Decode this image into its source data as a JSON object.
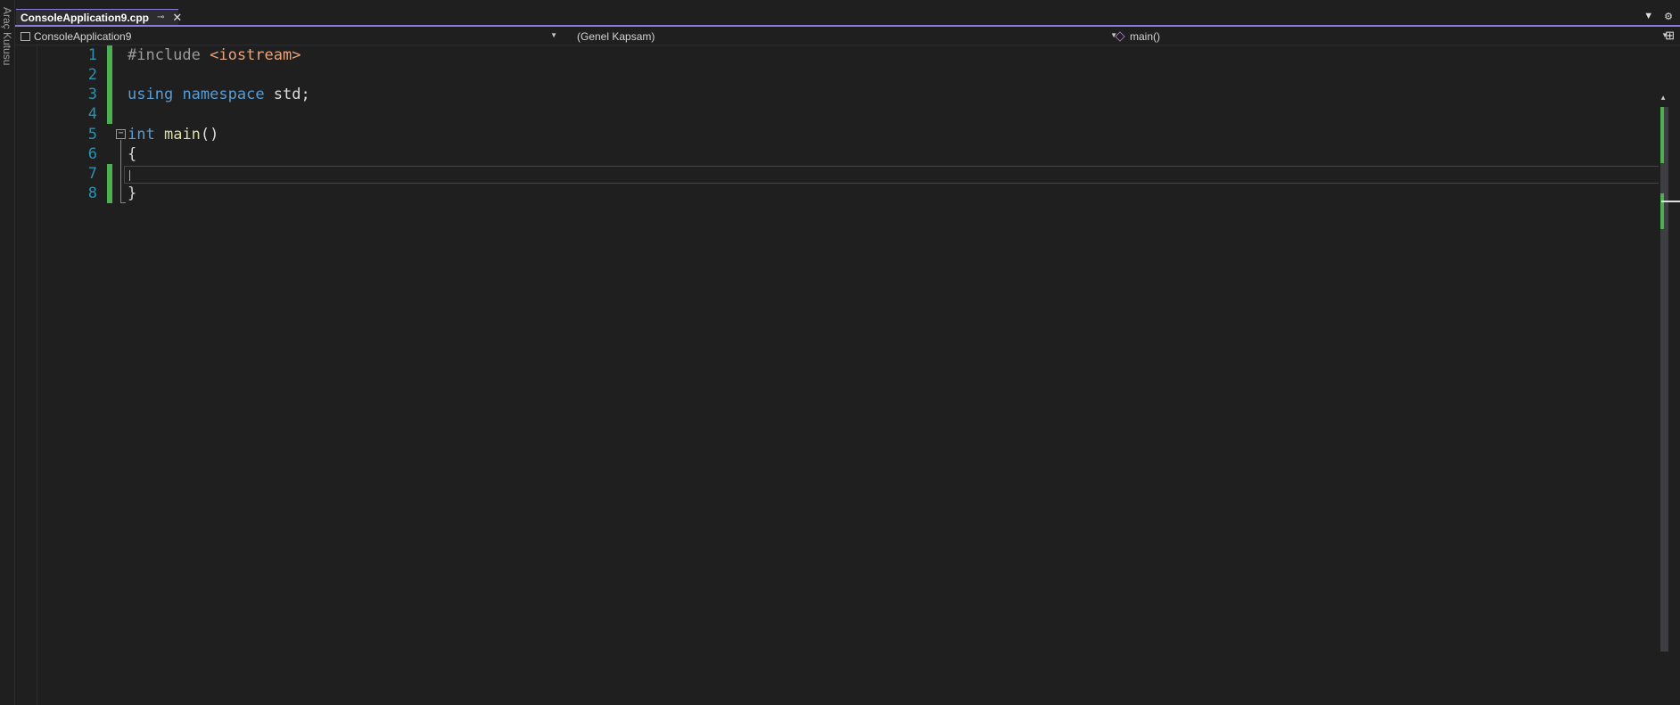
{
  "toolbox": {
    "label": "Araç Kutusu"
  },
  "tabs": [
    {
      "title": "ConsoleApplication9.cpp",
      "active": true
    }
  ],
  "tab_icons": {
    "pin": "pin-icon",
    "close": "close-icon",
    "dropdown": "chevron-down-icon",
    "settings": "gear-icon"
  },
  "navbar": {
    "project": "ConsoleApplication9",
    "scope": "(Genel Kapsam)",
    "member": "main()"
  },
  "editor": {
    "lines": [
      {
        "n": "1",
        "changed": true
      },
      {
        "n": "2",
        "changed": true
      },
      {
        "n": "3",
        "changed": true
      },
      {
        "n": "4",
        "changed": true
      },
      {
        "n": "5",
        "changed": false
      },
      {
        "n": "6",
        "changed": false
      },
      {
        "n": "7",
        "changed": true
      },
      {
        "n": "8",
        "changed": true
      }
    ],
    "code": {
      "l1_directive": "#include ",
      "l1_header": "<iostream>",
      "l3_kw1": "using",
      "l3_kw2": "namespace",
      "l3_rest": " std;",
      "l5_kw": "int",
      "l5_fn": "main",
      "l5_rest": "()",
      "l6": "{",
      "l8": "}"
    },
    "current_line": 7
  },
  "colors": {
    "keyword": "#569cd6",
    "line_number": "#2b91af",
    "include_path": "#e8a47c",
    "function": "#dcdcaa",
    "change_marker": "#4caf50",
    "tab_accent": "#8b7bd8"
  }
}
